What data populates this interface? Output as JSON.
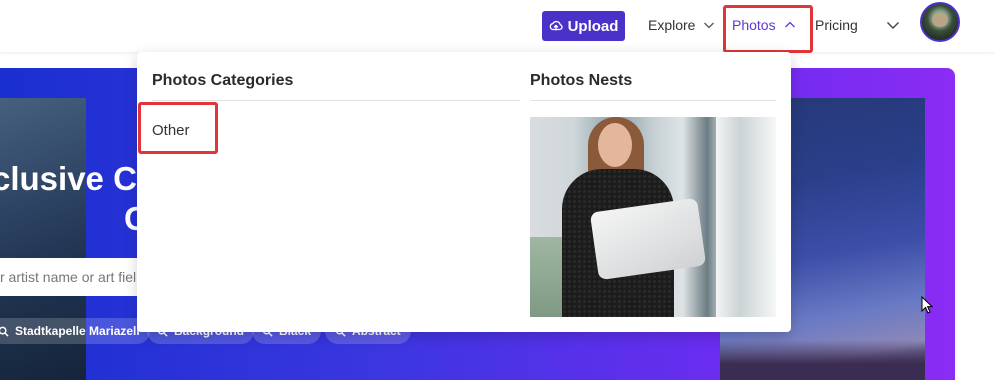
{
  "header": {
    "upload_label": "Upload",
    "nav": {
      "explore": "Explore",
      "photos": "Photos",
      "pricing": "Pricing"
    }
  },
  "hero": {
    "title_line1": "clusive C",
    "title_line2": "C",
    "search_placeholder": "r artist name or art fiel",
    "tags": [
      "Stadtkapelle Mariazell",
      "Background",
      "Black",
      "Abstract"
    ]
  },
  "dropdown": {
    "categories_heading": "Photos Categories",
    "nests_heading": "Photos Nests",
    "categories": [
      "Other"
    ]
  },
  "colors": {
    "accent": "#4a32c8",
    "active_nav": "#6237d6",
    "highlight": "#e0353a"
  },
  "icons": [
    "upload-cloud-icon",
    "chevron-down-icon",
    "chevron-up-icon",
    "search-icon",
    "mouse-cursor-icon"
  ]
}
